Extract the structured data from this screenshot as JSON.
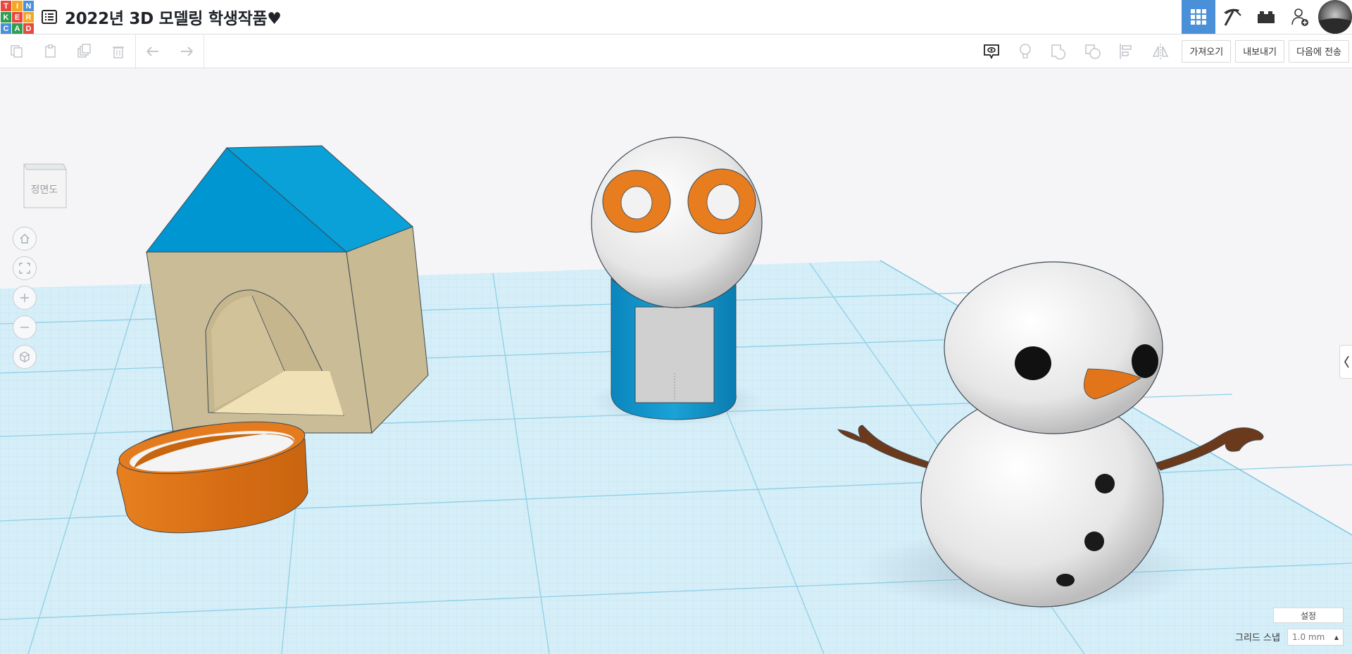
{
  "app": {
    "logo_letters": [
      "T",
      "I",
      "N",
      "K",
      "E",
      "R",
      "C",
      "A",
      "D"
    ],
    "logo_colors": [
      "#e8493f",
      "#f5a623",
      "#4a90d9",
      "#2e9e4f",
      "#e8493f",
      "#f5a623",
      "#4a90d9",
      "#2e9e4f",
      "#e8493f"
    ],
    "title": "2022년 3D 모델링 학생작품♥"
  },
  "header": {
    "icons": [
      "grid-view-icon",
      "pickaxe-icon",
      "bricks-icon",
      "add-user-icon",
      "avatar"
    ]
  },
  "toolbar": {
    "left_icons": [
      "copy-icon",
      "paste-icon",
      "duplicate-icon",
      "delete-icon",
      "undo-icon",
      "redo-icon"
    ],
    "right_icons": [
      "notes-icon",
      "light-bulb-icon",
      "group-icon",
      "ungroup-icon",
      "align-icon",
      "mirror-icon"
    ],
    "import_label": "가져오기",
    "export_label": "내보내기",
    "send_to_label": "다음에 전송"
  },
  "viewport": {
    "viewcube_label": "정면도",
    "nav_controls": [
      "home-view",
      "fit-all",
      "zoom-in",
      "zoom-out",
      "perspective-toggle"
    ],
    "settings_label": "설정",
    "grid_snap_label": "그리드 스냅",
    "grid_snap_value": "1.0 mm"
  },
  "colors": {
    "accent": "#4a90d9",
    "grid_line": "#9fd3e6",
    "workplane": "#d9eff7",
    "roof_blue": "#0096d1",
    "wall_tan": "#c6b88f",
    "orange": "#e37a1f",
    "stick_brown": "#6b3a1d"
  }
}
